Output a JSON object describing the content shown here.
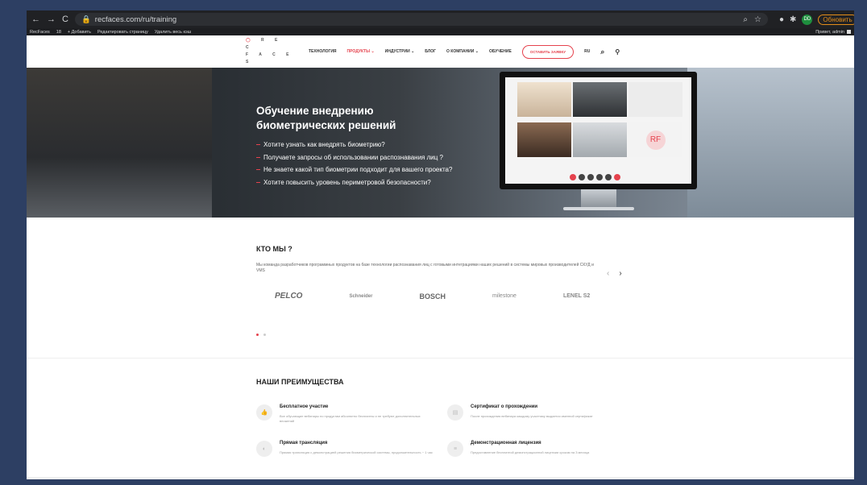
{
  "browser": {
    "url": "recfaces.com/ru/training",
    "nav": [
      "←",
      "→",
      "C"
    ],
    "update_label": "Обновить",
    "avatar_initials": "DD",
    "bookmarks": [
      "RecFaces",
      "18",
      "+ Добавить",
      "Редактировать страницу",
      "Удалить весь кэш"
    ],
    "greeting": "Привет, admin"
  },
  "site": {
    "logo_top": "R E C",
    "logo_bottom": "F A C E S",
    "nav": [
      "ТЕХНОЛОГИЯ",
      "ПРОДУКТЫ",
      "ИНДУСТРИИ",
      "БЛОГ",
      "О КОМПАНИИ",
      "ОБУЧЕНИЕ"
    ],
    "cta": "ОСТАВИТЬ ЗАЯВКУ",
    "lang": "RU",
    "accent": "#e5424d"
  },
  "hero": {
    "title": "Обучение внедрению биометрических решений",
    "items": [
      "Хотите узнать как внедрять биометрию?",
      "Получаете запросы об использовании распознавания лиц ?",
      "Не знаете какой тип биометрии подходит для вашего проекта?",
      "Хотите повысить уровень периметровой безопасности?"
    ],
    "monitor_badge": "RF"
  },
  "who": {
    "title": "КТО МЫ ?",
    "text": "Мы команда разработчиков программных продуктов на базе технологии распознавания лиц с готовыми интеграциями наших решений в системы мировых производителей СКУД и VMS",
    "partners": [
      "PELCO",
      "Schneider",
      "BOSCH",
      "milestone",
      "LENEL S2"
    ]
  },
  "advantages": {
    "title": "НАШИ ПРЕИМУЩЕСТВА",
    "items": [
      {
        "title": "Бесплатное участие",
        "desc": "Все обучающие вебинары по продуктам абсолютно бесплатны и не требуют дополнительных вложений"
      },
      {
        "title": "Сертификат о прохождении",
        "desc": "После прохождения вебинара каждому участнику выдается именной сертификат"
      },
      {
        "title": "Прямая трансляция",
        "desc": "Прямая трансляция с демонстрацией решения биометрической системы, продолжительность ~ 1 час"
      },
      {
        "title": "Демонстрационная лицензия",
        "desc": "Предоставление бесплатной демонстрационной лицензии сроком на 3 месяца"
      }
    ]
  }
}
